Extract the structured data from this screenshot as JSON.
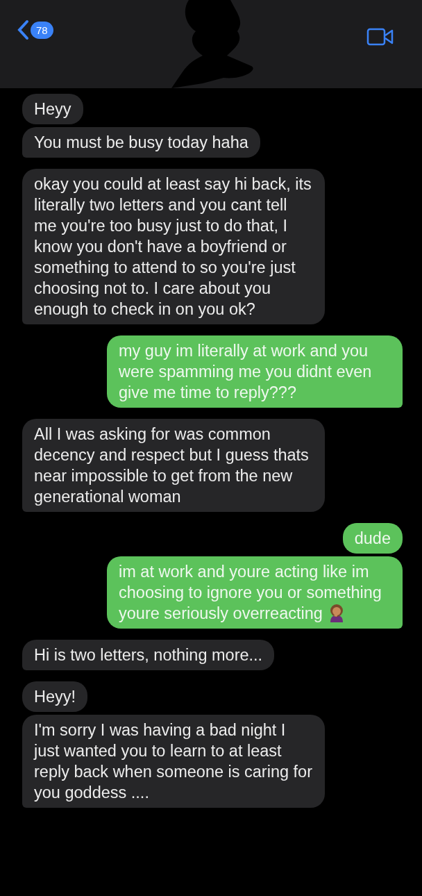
{
  "header": {
    "unread_count": "78"
  },
  "messages": [
    {
      "kind": "received",
      "text": "Heyy",
      "tail": false
    },
    {
      "kind": "received",
      "text": "You must be busy today haha",
      "tail": true
    },
    {
      "kind": "received",
      "text": "okay you could at least say hi back, its literally two letters and you cant tell me you're too busy just to do that, I know you don't have a boyfriend or something to attend to so you're just choosing not to. I care about you enough to check in on you ok?",
      "tail": true
    },
    {
      "kind": "sent",
      "text": "my guy im literally at work and you were spamming me you didnt even give me time to reply???",
      "tail": true
    },
    {
      "kind": "received",
      "text": "All I was asking for was common decency and respect but I guess thats near impossible to get from the new generational woman",
      "tail": true
    },
    {
      "kind": "sent",
      "text": "dude",
      "tail": false
    },
    {
      "kind": "sent",
      "text": "im at work and youre acting like im choosing to ignore you or something youre seriously overreacting",
      "tail": true,
      "emoji": true
    },
    {
      "kind": "received",
      "text": "Hi is two letters, nothing more...",
      "tail": true
    },
    {
      "kind": "received",
      "text": "Heyy!",
      "tail": false
    },
    {
      "kind": "received",
      "text": "I'm sorry I was having a bad night I just wanted you to learn to at least reply back when someone is caring for you goddess ....",
      "tail": true
    }
  ]
}
